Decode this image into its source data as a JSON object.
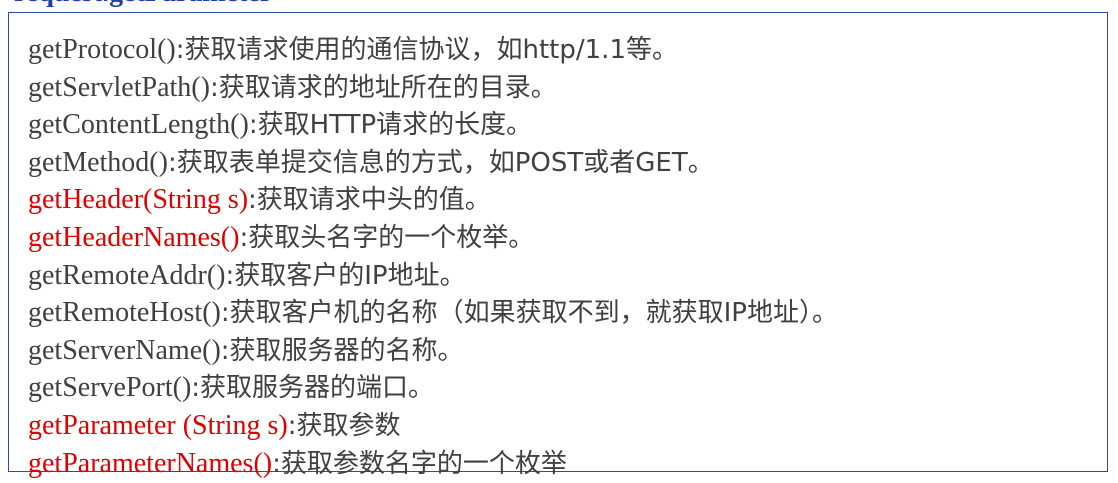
{
  "header_fragment": "request.getParameter",
  "colors": {
    "border": "#2c4aa6",
    "text": "#404040",
    "highlight": "#e00000"
  },
  "lines": [
    {
      "method": "getProtocol()",
      "desc": ":获取请求使用的通信协议，如http/1.1等。",
      "highlight": false
    },
    {
      "method": "getServletPath()",
      "desc": ":获取请求的地址所在的目录。",
      "highlight": false
    },
    {
      "method": "getContentLength()",
      "desc": ":获取HTTP请求的长度。",
      "highlight": false
    },
    {
      "method": "getMethod()",
      "desc": ":获取表单提交信息的方式，如POST或者GET。",
      "highlight": false
    },
    {
      "method": "getHeader(String s)",
      "desc": ":获取请求中头的值。",
      "highlight": true
    },
    {
      "method": "getHeaderNames()",
      "desc": ":获取头名字的一个枚举。",
      "highlight": true
    },
    {
      "method": "getRemoteAddr()",
      "desc": ":获取客户的IP地址。",
      "highlight": false
    },
    {
      "method": "getRemoteHost()",
      "desc": ":获取客户机的名称（如果获取不到，就获取IP地址）。",
      "highlight": false
    },
    {
      "method": "getServerName()",
      "desc": ":获取服务器的名称。",
      "highlight": false
    },
    {
      "method": "getServePort()",
      "desc": ":获取服务器的端口。",
      "highlight": false
    },
    {
      "method": "getParameter (String s)",
      "desc": ":获取参数",
      "highlight": true
    },
    {
      "method": "getParameterNames()",
      "desc": ":获取参数名字的一个枚举",
      "highlight": true
    }
  ]
}
